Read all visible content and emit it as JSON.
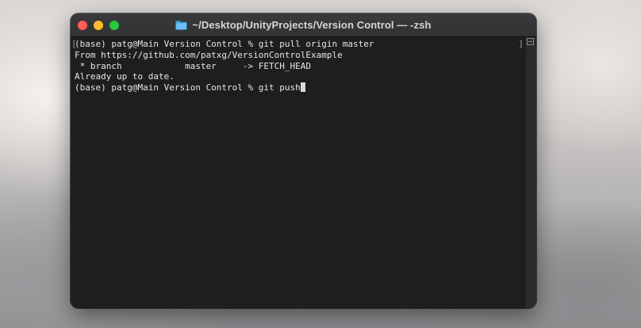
{
  "window": {
    "title": "~/Desktop/UnityProjects/Version Control — -zsh",
    "title_icon": "folder-icon",
    "controls": {
      "close": "close-icon",
      "minimize": "minimize-icon",
      "zoom": "zoom-icon"
    }
  },
  "terminal": {
    "lines": [
      "(base) patg@Main Version Control % git pull origin master",
      "From https://github.com/patxg/VersionControlExample",
      " * branch            master     -> FETCH_HEAD",
      "Already up to date.",
      "(base) patg@Main Version Control % git push"
    ],
    "left_marker": "[",
    "right_marker": "]"
  },
  "colors": {
    "close": "#ff5f57",
    "minimize": "#febc2e",
    "zoom": "#28c840",
    "terminal_bg": "#1e1e1e",
    "terminal_fg": "#e6e6e6",
    "folder": "#4aa3df"
  }
}
